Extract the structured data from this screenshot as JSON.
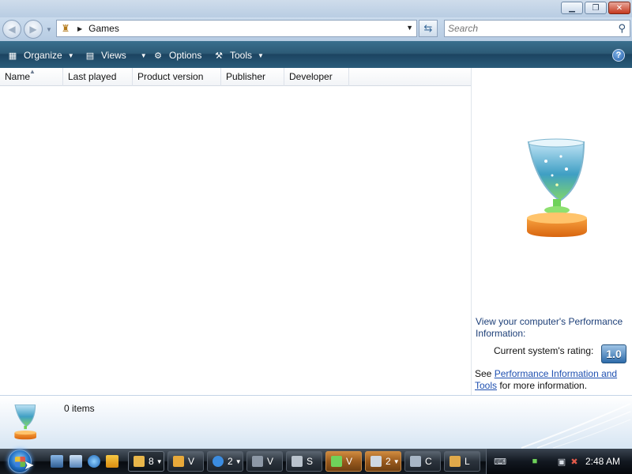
{
  "window": {
    "minimize_icon": "minimize-icon",
    "maximize_icon": "maximize-icon",
    "close_icon": "close-icon"
  },
  "address_bar": {
    "path": "Games",
    "search_placeholder": "Search"
  },
  "command_bar": {
    "organize": "Organize",
    "views": "Views",
    "options": "Options",
    "tools": "Tools",
    "help": "?"
  },
  "columns": [
    "Name",
    "Last played",
    "Product version",
    "Publisher",
    "Developer"
  ],
  "info_pane": {
    "perf_text": "View your computer's Performance Information:",
    "rating_label": "Current system's rating:",
    "rating_value": "1.0",
    "see_prefix": "See ",
    "see_link": "Performance Information and Tools",
    "see_suffix": " for more information."
  },
  "details": {
    "items_count": "0 items"
  },
  "taskbar": {
    "buttons": [
      {
        "label": "8",
        "state": "normal"
      },
      {
        "label": "V",
        "state": "normal"
      },
      {
        "label": "2",
        "state": "normal"
      },
      {
        "label": "V",
        "state": "normal"
      },
      {
        "label": "S",
        "state": "normal"
      },
      {
        "label": "V",
        "state": "active"
      },
      {
        "label": "2",
        "state": "active"
      },
      {
        "label": "C",
        "state": "normal"
      },
      {
        "label": "L",
        "state": "normal"
      }
    ],
    "clock": "2:48 AM"
  },
  "colors": {
    "command_bar": "#2d5b77",
    "link": "#1d4fb0",
    "rating_badge": "#2e6ba9"
  }
}
